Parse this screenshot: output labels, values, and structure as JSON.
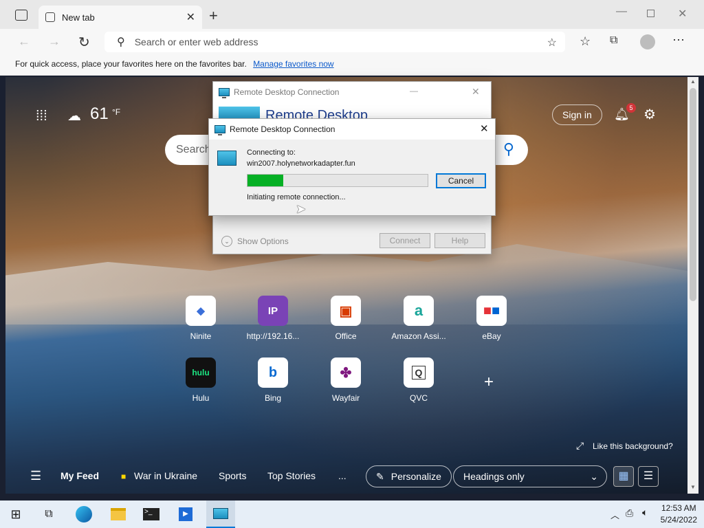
{
  "browser": {
    "tab_title": "New tab",
    "address_placeholder": "Search or enter web address",
    "favorites_hint": "For quick access, place your favorites here on the favorites bar.",
    "favorites_link": "Manage favorites now"
  },
  "ntp": {
    "temperature": "61",
    "temp_unit": "°F",
    "search_placeholder": "Search",
    "sign_in": "Sign in",
    "notification_count": "5",
    "quick_links": [
      {
        "label": "Ninite",
        "icon": "ninite-icon"
      },
      {
        "label": "http://192.16...",
        "icon": "ip-icon",
        "glyph": "IP"
      },
      {
        "label": "Office",
        "icon": "office-icon"
      },
      {
        "label": "Amazon Assi...",
        "icon": "amazon-icon",
        "glyph": "a"
      },
      {
        "label": "eBay",
        "icon": "ebay-icon"
      },
      {
        "label": "Hulu",
        "icon": "hulu-icon",
        "glyph": "hulu"
      },
      {
        "label": "Bing",
        "icon": "bing-icon",
        "glyph": "b"
      },
      {
        "label": "Wayfair",
        "icon": "wayfair-icon"
      },
      {
        "label": "QVC",
        "icon": "qvc-icon",
        "glyph": "Q"
      }
    ],
    "like_background": "Like this background?",
    "feed": {
      "my_feed": "My Feed",
      "war_in_ukraine": "War in Ukraine",
      "sports": "Sports",
      "top_stories": "Top Stories",
      "more": "...",
      "personalize": "Personalize",
      "headings": "Headings only"
    }
  },
  "rdc_back": {
    "title": "Remote Desktop Connection",
    "header": "Remote Desktop",
    "show_options": "Show Options",
    "connect": "Connect",
    "help": "Help"
  },
  "rdc_front": {
    "title": "Remote Desktop Connection",
    "connecting_to": "Connecting to:",
    "host": "win2007.holynetworkadapter.fun",
    "progress": 0.2,
    "status": "Initiating remote connection...",
    "cancel": "Cancel"
  },
  "taskbar": {
    "time": "12:53 AM",
    "date": "5/24/2022"
  }
}
